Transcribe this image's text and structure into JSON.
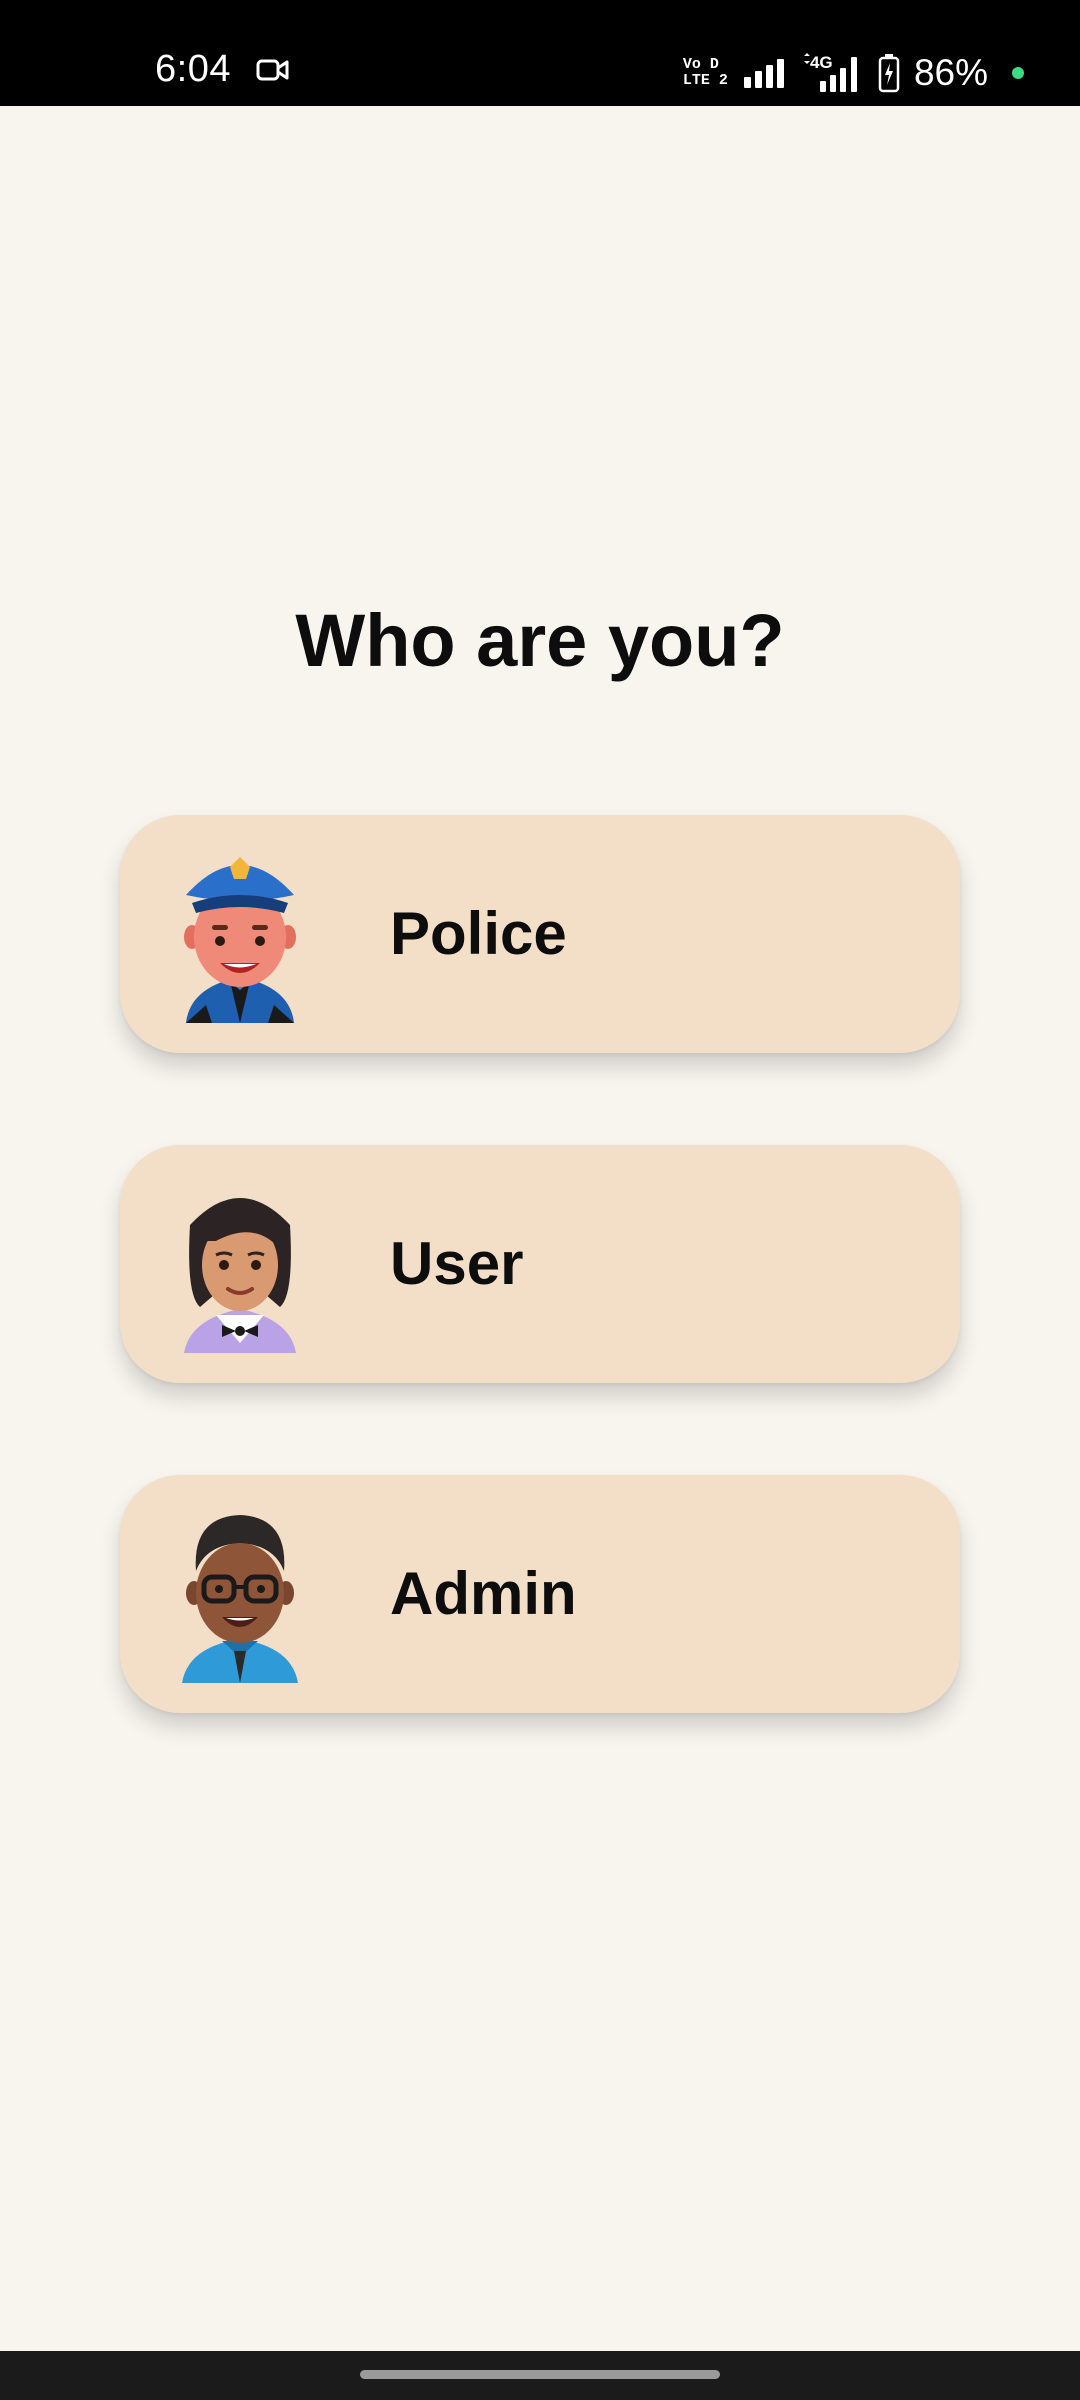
{
  "status_bar": {
    "time": "6:04",
    "volte_line1": "Vo D",
    "volte_line2": "LTE 2",
    "network_type": "4G",
    "battery_percent": "86%",
    "icons": [
      "video-camera-icon",
      "volte-icon",
      "signal-icon",
      "signal-4g-icon",
      "battery-charging-icon",
      "privacy-dot-icon"
    ],
    "dot_color": "#3DDC84"
  },
  "page": {
    "title": "Who are you?"
  },
  "roles": [
    {
      "label": "Police",
      "avatar": "police-avatar-icon"
    },
    {
      "label": "User",
      "avatar": "user-avatar-icon"
    },
    {
      "label": "Admin",
      "avatar": "admin-avatar-icon"
    }
  ],
  "colors": {
    "background": "#F8F5EF",
    "card": "#F3DFC7",
    "text": "#0D0D0D"
  }
}
